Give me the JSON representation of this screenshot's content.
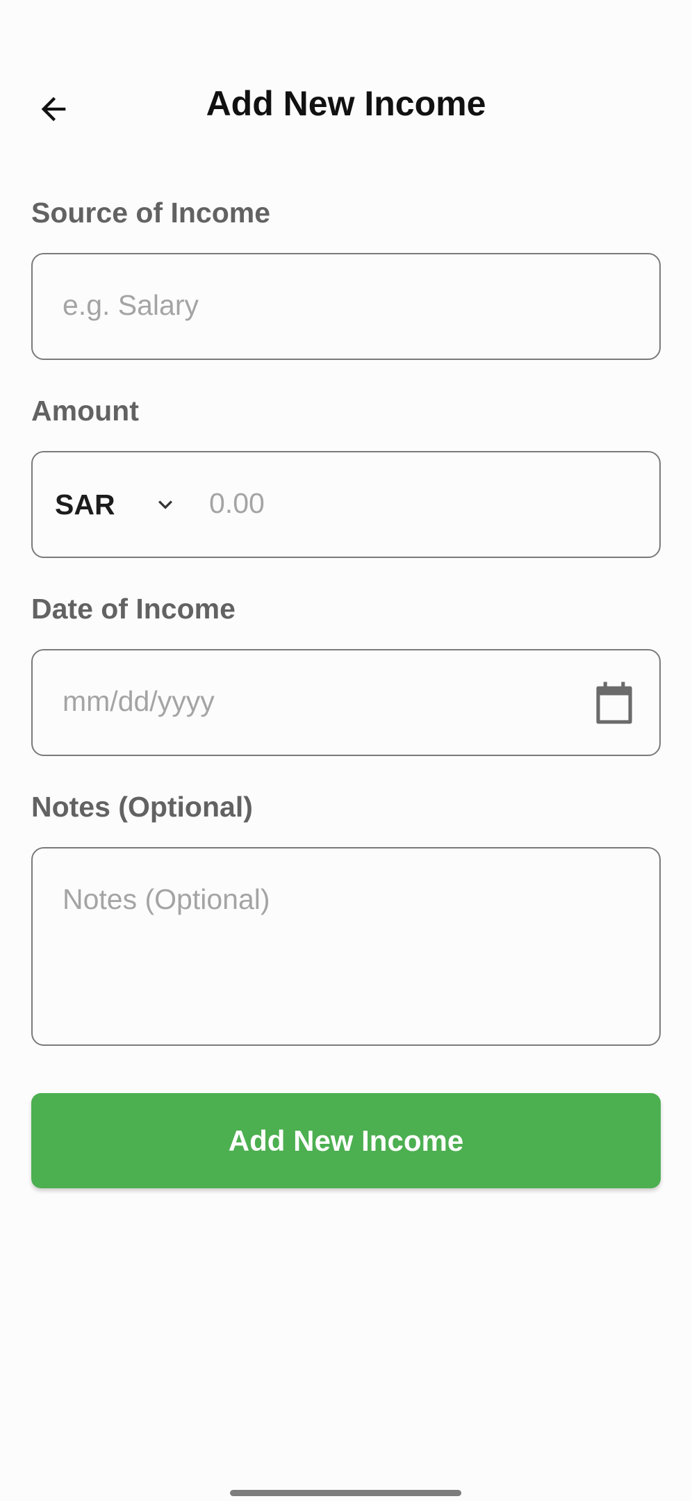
{
  "header": {
    "title": "Add New Income",
    "back_icon": "arrow-left-icon"
  },
  "form": {
    "source": {
      "label": "Source of Income",
      "placeholder": "e.g. Salary",
      "value": ""
    },
    "amount": {
      "label": "Amount",
      "currency": "SAR",
      "currency_icon": "chevron-down-icon",
      "placeholder": "0.00",
      "value": ""
    },
    "date": {
      "label": "Date of Income",
      "placeholder": "mm/dd/yyyy",
      "value": "",
      "icon": "calendar-icon"
    },
    "notes": {
      "label": "Notes (Optional)",
      "placeholder": "Notes (Optional)",
      "value": ""
    },
    "submit_label": "Add New Income"
  },
  "colors": {
    "accent": "#4caf50",
    "background": "#fdfcfc",
    "border": "#7a7a7a",
    "label": "#626262",
    "placeholder": "#a4a4a4"
  }
}
